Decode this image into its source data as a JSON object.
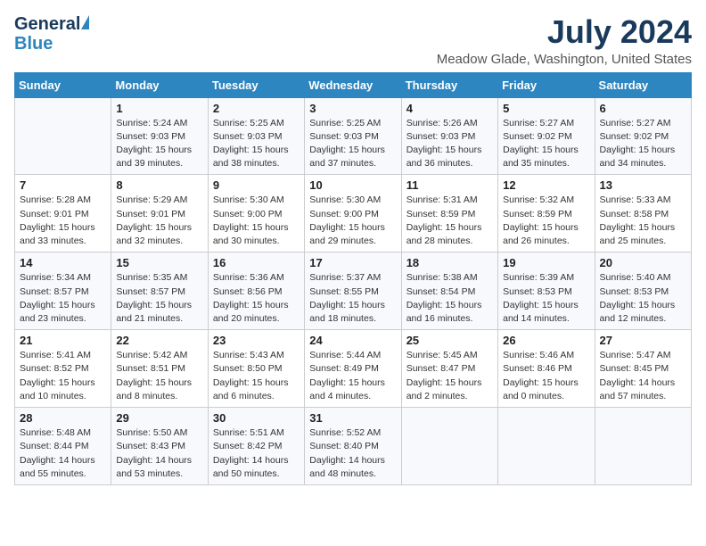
{
  "header": {
    "logo_general": "General",
    "logo_blue": "Blue",
    "month": "July 2024",
    "location": "Meadow Glade, Washington, United States"
  },
  "weekdays": [
    "Sunday",
    "Monday",
    "Tuesday",
    "Wednesday",
    "Thursday",
    "Friday",
    "Saturday"
  ],
  "weeks": [
    [
      {
        "num": "",
        "info": ""
      },
      {
        "num": "1",
        "info": "Sunrise: 5:24 AM\nSunset: 9:03 PM\nDaylight: 15 hours\nand 39 minutes."
      },
      {
        "num": "2",
        "info": "Sunrise: 5:25 AM\nSunset: 9:03 PM\nDaylight: 15 hours\nand 38 minutes."
      },
      {
        "num": "3",
        "info": "Sunrise: 5:25 AM\nSunset: 9:03 PM\nDaylight: 15 hours\nand 37 minutes."
      },
      {
        "num": "4",
        "info": "Sunrise: 5:26 AM\nSunset: 9:03 PM\nDaylight: 15 hours\nand 36 minutes."
      },
      {
        "num": "5",
        "info": "Sunrise: 5:27 AM\nSunset: 9:02 PM\nDaylight: 15 hours\nand 35 minutes."
      },
      {
        "num": "6",
        "info": "Sunrise: 5:27 AM\nSunset: 9:02 PM\nDaylight: 15 hours\nand 34 minutes."
      }
    ],
    [
      {
        "num": "7",
        "info": "Sunrise: 5:28 AM\nSunset: 9:01 PM\nDaylight: 15 hours\nand 33 minutes."
      },
      {
        "num": "8",
        "info": "Sunrise: 5:29 AM\nSunset: 9:01 PM\nDaylight: 15 hours\nand 32 minutes."
      },
      {
        "num": "9",
        "info": "Sunrise: 5:30 AM\nSunset: 9:00 PM\nDaylight: 15 hours\nand 30 minutes."
      },
      {
        "num": "10",
        "info": "Sunrise: 5:30 AM\nSunset: 9:00 PM\nDaylight: 15 hours\nand 29 minutes."
      },
      {
        "num": "11",
        "info": "Sunrise: 5:31 AM\nSunset: 8:59 PM\nDaylight: 15 hours\nand 28 minutes."
      },
      {
        "num": "12",
        "info": "Sunrise: 5:32 AM\nSunset: 8:59 PM\nDaylight: 15 hours\nand 26 minutes."
      },
      {
        "num": "13",
        "info": "Sunrise: 5:33 AM\nSunset: 8:58 PM\nDaylight: 15 hours\nand 25 minutes."
      }
    ],
    [
      {
        "num": "14",
        "info": "Sunrise: 5:34 AM\nSunset: 8:57 PM\nDaylight: 15 hours\nand 23 minutes."
      },
      {
        "num": "15",
        "info": "Sunrise: 5:35 AM\nSunset: 8:57 PM\nDaylight: 15 hours\nand 21 minutes."
      },
      {
        "num": "16",
        "info": "Sunrise: 5:36 AM\nSunset: 8:56 PM\nDaylight: 15 hours\nand 20 minutes."
      },
      {
        "num": "17",
        "info": "Sunrise: 5:37 AM\nSunset: 8:55 PM\nDaylight: 15 hours\nand 18 minutes."
      },
      {
        "num": "18",
        "info": "Sunrise: 5:38 AM\nSunset: 8:54 PM\nDaylight: 15 hours\nand 16 minutes."
      },
      {
        "num": "19",
        "info": "Sunrise: 5:39 AM\nSunset: 8:53 PM\nDaylight: 15 hours\nand 14 minutes."
      },
      {
        "num": "20",
        "info": "Sunrise: 5:40 AM\nSunset: 8:53 PM\nDaylight: 15 hours\nand 12 minutes."
      }
    ],
    [
      {
        "num": "21",
        "info": "Sunrise: 5:41 AM\nSunset: 8:52 PM\nDaylight: 15 hours\nand 10 minutes."
      },
      {
        "num": "22",
        "info": "Sunrise: 5:42 AM\nSunset: 8:51 PM\nDaylight: 15 hours\nand 8 minutes."
      },
      {
        "num": "23",
        "info": "Sunrise: 5:43 AM\nSunset: 8:50 PM\nDaylight: 15 hours\nand 6 minutes."
      },
      {
        "num": "24",
        "info": "Sunrise: 5:44 AM\nSunset: 8:49 PM\nDaylight: 15 hours\nand 4 minutes."
      },
      {
        "num": "25",
        "info": "Sunrise: 5:45 AM\nSunset: 8:47 PM\nDaylight: 15 hours\nand 2 minutes."
      },
      {
        "num": "26",
        "info": "Sunrise: 5:46 AM\nSunset: 8:46 PM\nDaylight: 15 hours\nand 0 minutes."
      },
      {
        "num": "27",
        "info": "Sunrise: 5:47 AM\nSunset: 8:45 PM\nDaylight: 14 hours\nand 57 minutes."
      }
    ],
    [
      {
        "num": "28",
        "info": "Sunrise: 5:48 AM\nSunset: 8:44 PM\nDaylight: 14 hours\nand 55 minutes."
      },
      {
        "num": "29",
        "info": "Sunrise: 5:50 AM\nSunset: 8:43 PM\nDaylight: 14 hours\nand 53 minutes."
      },
      {
        "num": "30",
        "info": "Sunrise: 5:51 AM\nSunset: 8:42 PM\nDaylight: 14 hours\nand 50 minutes."
      },
      {
        "num": "31",
        "info": "Sunrise: 5:52 AM\nSunset: 8:40 PM\nDaylight: 14 hours\nand 48 minutes."
      },
      {
        "num": "",
        "info": ""
      },
      {
        "num": "",
        "info": ""
      },
      {
        "num": "",
        "info": ""
      }
    ]
  ]
}
